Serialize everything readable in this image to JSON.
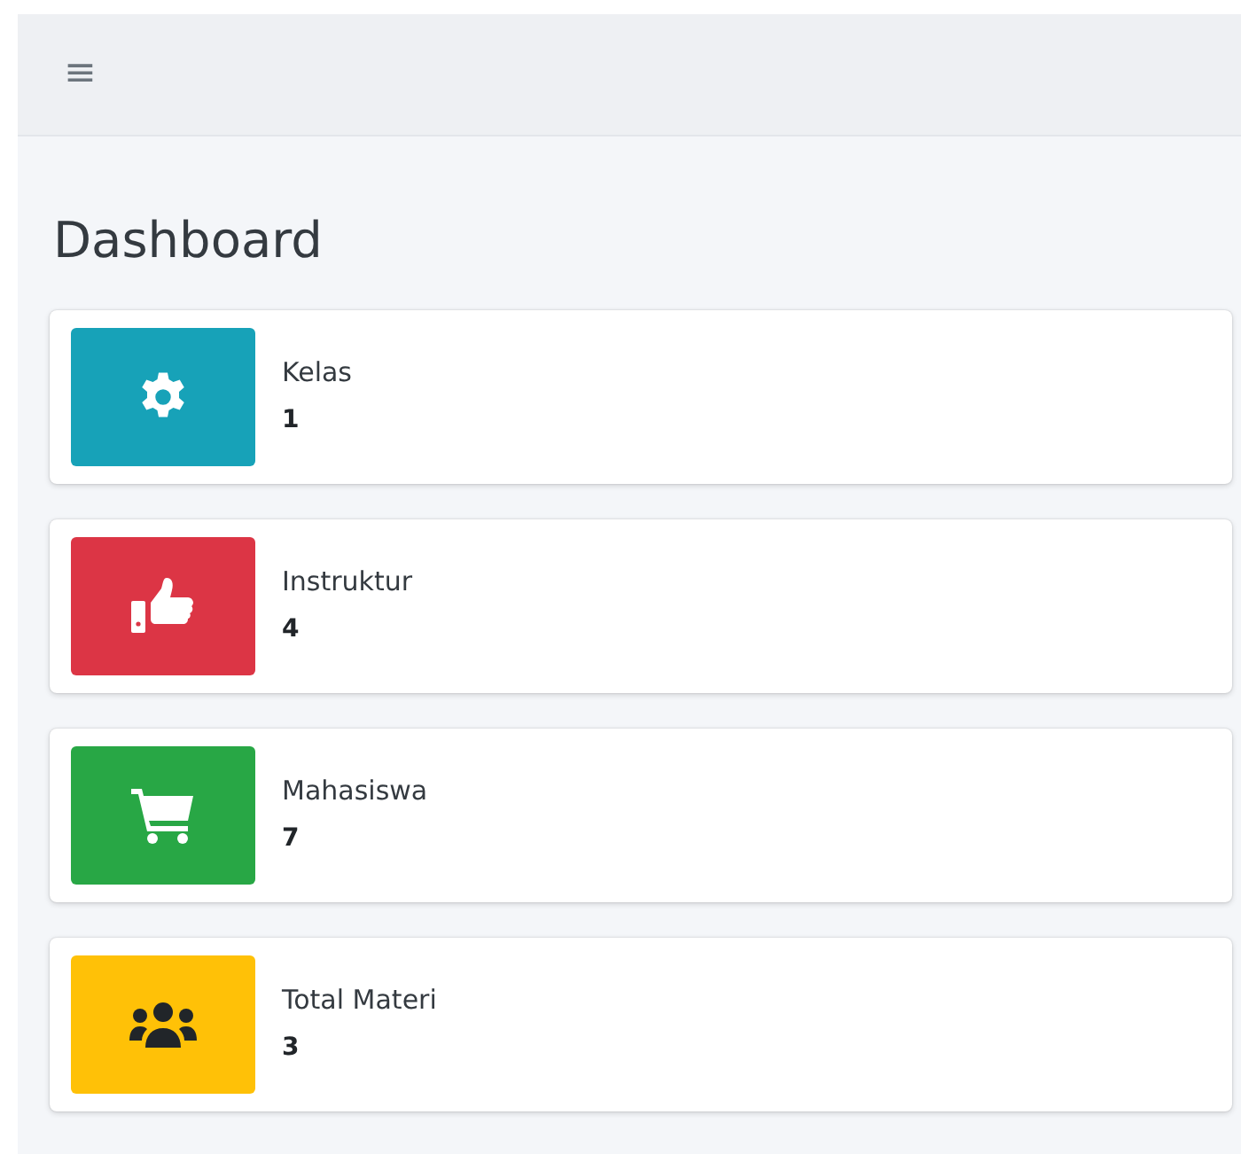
{
  "navbar": {
    "menu_icon": "≡"
  },
  "page_title": "Dashboard",
  "info_boxes": [
    {
      "label": "Kelas",
      "value": "1",
      "kind": "gear",
      "color": "#17a2b8"
    },
    {
      "label": "Instruktur",
      "value": "4",
      "kind": "thumbs-up",
      "color": "#dc3545"
    },
    {
      "label": "Mahasiswa",
      "value": "7",
      "kind": "cart",
      "color": "#28a745"
    },
    {
      "label": "Total Materi",
      "value": "3",
      "kind": "users",
      "color": "#ffc107"
    }
  ]
}
